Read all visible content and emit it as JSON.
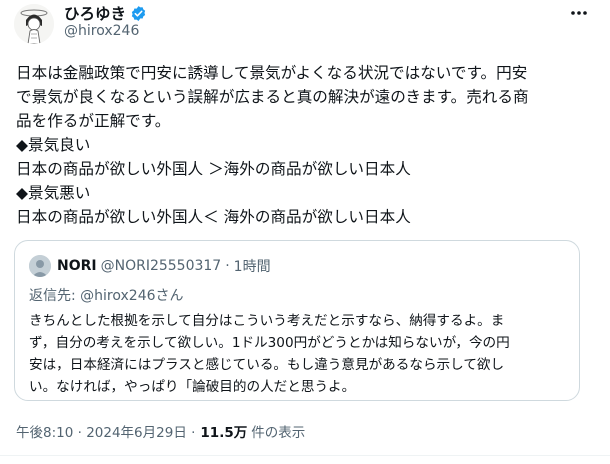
{
  "author": {
    "name": "ひろゆき",
    "handle": "@hirox246"
  },
  "tweet": {
    "text": "日本は金融政策で円安に誘導して景気がよくなる状況ではないです。円安\nで景気が良くなるという誤解が広まると真の解決が遠のきます。売れる商\n品を作るが正解です。\n◆景気良い\n日本の商品が欲しい外国人 ＞海外の商品が欲しい日本人\n◆景気悪い\n日本の商品が欲しい外国人＜ 海外の商品が欲しい日本人"
  },
  "quote": {
    "name": "NORI",
    "handle": "@NORI25550317",
    "dot": "·",
    "time": "1時間",
    "reply_to": "返信先: @hirox246さん",
    "text": "きちんとした根拠を示して自分はこういう考えだと示すなら、納得するよ。ま\nず，自分の考えを示して欲しい。1ドル300円がどうとかは知らないが，今の円\n安は，日本経済にはプラスと感じている。もし違う意見があるなら示して欲し\nい。なければ，やっぱり「論破目的の人だと思うよ。"
  },
  "meta": {
    "timestamp": "午後8:10 · 2024年6月29日 ·",
    "views": "11.5万",
    "views_label": "件の表示"
  },
  "colors": {
    "verified": "#1d9bf0",
    "secondary_text": "#536471",
    "border": "#cfd9de"
  },
  "icons": {
    "verified": "verified-badge-icon",
    "more": "more-dots-icon"
  }
}
